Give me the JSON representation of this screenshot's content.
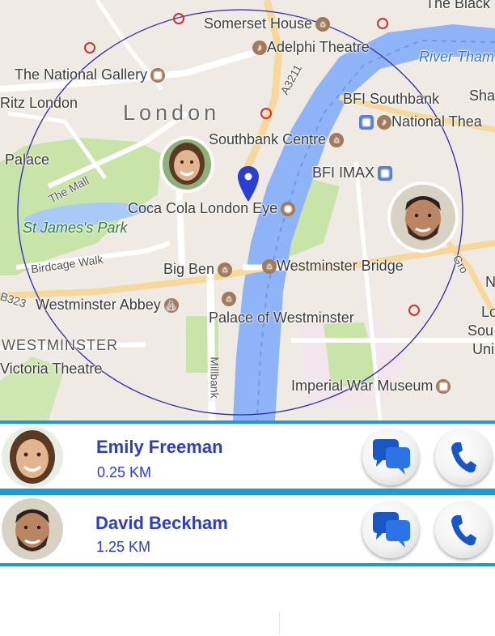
{
  "map": {
    "labels": {
      "somerset_house": "Somerset House",
      "adelphi_theatre": "Adelphi Theatre",
      "river_thames": "River Tham",
      "national_gallery": "The National Gallery",
      "ritz_london": "Ritz London",
      "london": "London",
      "a3211": "A3211",
      "bfi_southbank": "BFI Southbank",
      "sha": "Sha",
      "national_theatre": "National Thea",
      "palace": "Palace",
      "southbank_centre": "Southbank Centre",
      "the_mall": "The Mall",
      "bfi_imax": "BFI IMAX",
      "st_james_park": "St James's Park",
      "london_eye": "Coca Cola London Eye",
      "birdcage_walk": "Birdcage Walk",
      "big_ben": "Big Ben",
      "westminster_bridge": "Westminster Bridge",
      "b323": "B323",
      "westminster_abbey": "Westminster Abbey",
      "palace_of_westminster": "Palace of Westminster",
      "westminster": "WESTMINSTER",
      "victoria_theatre": "Victoria Theatre",
      "millbank": "Millbank",
      "imperial_war_museum": "Imperial War Museum",
      "lo": "Lo",
      "sou": "Sou",
      "uni": "Uni",
      "n": "N",
      "the_black": "The Black",
      "gro": "Gro"
    }
  },
  "contacts": [
    {
      "name": "Emily Freeman",
      "distance": "0.25 KM"
    },
    {
      "name": "David Beckham",
      "distance": "1.25 KM"
    }
  ],
  "icons": {
    "chat": "chat-bubbles-icon",
    "call": "phone-icon",
    "pin": "location-pin-icon"
  },
  "colors": {
    "accent": "#1e9ad6",
    "name_text": "#2d3fbf",
    "river": "#8fb3f7",
    "park": "#c5e3a5",
    "radius_circle": "#2a2ab0"
  }
}
